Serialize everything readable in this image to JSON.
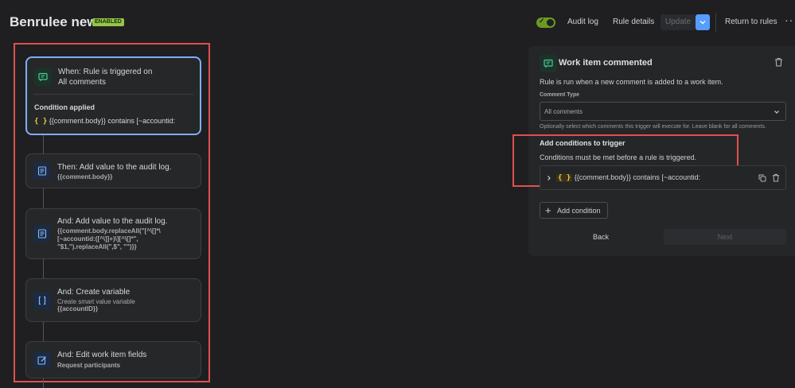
{
  "header": {
    "title": "Benrulee new",
    "status_badge": "ENABLED",
    "audit_log": "Audit log",
    "rule_details": "Rule details",
    "update": "Update",
    "return_to_rules": "Return to rules",
    "more": "···"
  },
  "flow": {
    "trigger": {
      "title": "When: Rule is triggered on",
      "subtitle": "All comments",
      "condition_label": "Condition applied",
      "condition_brace": "{ }",
      "condition_text": "{{comment.body}} contains [~accountid:"
    },
    "steps": [
      {
        "title": "Then: Add value to the audit log.",
        "lines": [
          "{{comment.body}}"
        ]
      },
      {
        "title": "And: Add value to the audit log.",
        "lines": [
          "{{comment.body.replaceAll(\"[^\\[]*\\",
          "[~accountid:([^\\]]+)\\][^\\[]*\",",
          "\"$1,\").replaceAll(\",$\", \"\")}}"
        ]
      },
      {
        "title": "And: Create variable",
        "lines": [
          "Create smart value variable",
          "{{accountID}}"
        ]
      },
      {
        "title": "And: Edit work item fields",
        "lines": [
          "Request participants"
        ]
      }
    ]
  },
  "panel": {
    "title": "Work item commented",
    "description": "Rule is run when a new comment is added to a work item.",
    "comment_type_label": "Comment Type",
    "comment_type_value": "All comments",
    "help_text": "Optionally select which comments this trigger will execute for. Leave blank for all comments.",
    "conditions_heading": "Add conditions to trigger",
    "conditions_sub": "Conditions must be met before a rule is triggered.",
    "condition_brace": "{ }",
    "condition_text": "{{comment.body}} contains [~accountid:",
    "add_condition": "Add condition",
    "back": "Back",
    "next": "Next"
  },
  "colors": {
    "background": "#1f1f21",
    "accent_blue": "#579dff",
    "enabled_green": "#94c748",
    "highlight_red": "#e05050"
  }
}
